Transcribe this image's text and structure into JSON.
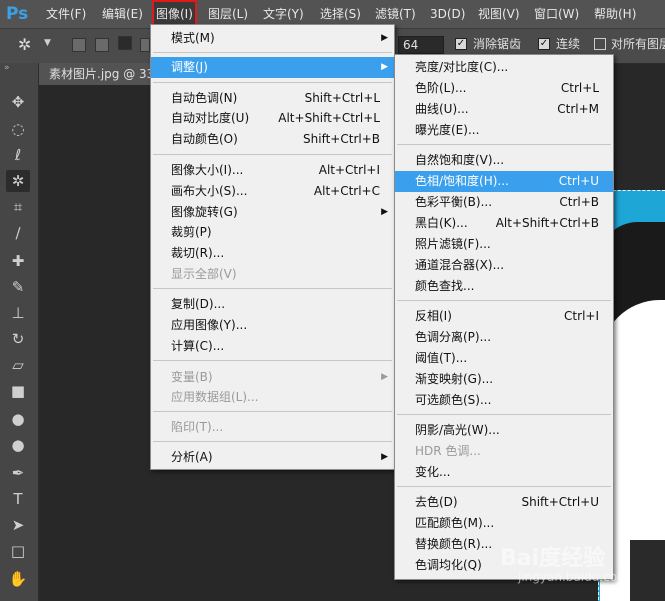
{
  "app": {
    "logo": "Ps"
  },
  "menubar": {
    "items": [
      {
        "label": "文件(F)"
      },
      {
        "label": "编辑(E)"
      },
      {
        "label": "图像(I)"
      },
      {
        "label": "图层(L)"
      },
      {
        "label": "文字(Y)"
      },
      {
        "label": "选择(S)"
      },
      {
        "label": "滤镜(T)"
      },
      {
        "label": "3D(D)"
      },
      {
        "label": "视图(V)"
      },
      {
        "label": "窗口(W)"
      },
      {
        "label": "帮助(H)"
      }
    ],
    "active": "图像(I)"
  },
  "options": {
    "tolerance_value": "64",
    "antialias_label": "消除锯齿",
    "contiguous_label": "连续",
    "sample_all_label": "对所有图层"
  },
  "document": {
    "tab_label": "素材图片.jpg @ 33"
  },
  "image_menu": {
    "items": [
      {
        "label": "模式(M)",
        "shortcut": "",
        "submenu": true,
        "disabled": false
      },
      {
        "label": "调整(J)",
        "shortcut": "",
        "submenu": true,
        "disabled": false,
        "highlighted": true
      },
      {
        "label": "自动色调(N)",
        "shortcut": "Shift+Ctrl+L"
      },
      {
        "label": "自动对比度(U)",
        "shortcut": "Alt+Shift+Ctrl+L"
      },
      {
        "label": "自动颜色(O)",
        "shortcut": "Shift+Ctrl+B"
      },
      {
        "label": "图像大小(I)...",
        "shortcut": "Alt+Ctrl+I"
      },
      {
        "label": "画布大小(S)...",
        "shortcut": "Alt+Ctrl+C"
      },
      {
        "label": "图像旋转(G)",
        "shortcut": "",
        "submenu": true
      },
      {
        "label": "裁剪(P)",
        "shortcut": ""
      },
      {
        "label": "裁切(R)...",
        "shortcut": ""
      },
      {
        "label": "显示全部(V)",
        "shortcut": "",
        "disabled": true
      },
      {
        "label": "复制(D)...",
        "shortcut": ""
      },
      {
        "label": "应用图像(Y)...",
        "shortcut": ""
      },
      {
        "label": "计算(C)...",
        "shortcut": ""
      },
      {
        "label": "变量(B)",
        "shortcut": "",
        "submenu": true,
        "disabled": true
      },
      {
        "label": "应用数据组(L)...",
        "shortcut": "",
        "disabled": true
      },
      {
        "label": "陷印(T)...",
        "shortcut": "",
        "disabled": true
      },
      {
        "label": "分析(A)",
        "shortcut": "",
        "submenu": true
      }
    ]
  },
  "adjust_menu": {
    "items": [
      {
        "label": "亮度/对比度(C)...",
        "shortcut": ""
      },
      {
        "label": "色阶(L)...",
        "shortcut": "Ctrl+L"
      },
      {
        "label": "曲线(U)...",
        "shortcut": "Ctrl+M"
      },
      {
        "label": "曝光度(E)...",
        "shortcut": ""
      },
      {
        "label": "自然饱和度(V)...",
        "shortcut": ""
      },
      {
        "label": "色相/饱和度(H)...",
        "shortcut": "Ctrl+U",
        "highlighted": true
      },
      {
        "label": "色彩平衡(B)...",
        "shortcut": "Ctrl+B"
      },
      {
        "label": "黑白(K)...",
        "shortcut": "Alt+Shift+Ctrl+B"
      },
      {
        "label": "照片滤镜(F)...",
        "shortcut": ""
      },
      {
        "label": "通道混合器(X)...",
        "shortcut": ""
      },
      {
        "label": "颜色查找...",
        "shortcut": ""
      },
      {
        "label": "反相(I)",
        "shortcut": "Ctrl+I"
      },
      {
        "label": "色调分离(P)...",
        "shortcut": ""
      },
      {
        "label": "阈值(T)...",
        "shortcut": ""
      },
      {
        "label": "渐变映射(G)...",
        "shortcut": ""
      },
      {
        "label": "可选颜色(S)...",
        "shortcut": ""
      },
      {
        "label": "阴影/高光(W)...",
        "shortcut": ""
      },
      {
        "label": "HDR 色调...",
        "shortcut": "",
        "disabled": true
      },
      {
        "label": "变化...",
        "shortcut": ""
      },
      {
        "label": "去色(D)",
        "shortcut": "Shift+Ctrl+U"
      },
      {
        "label": "匹配颜色(M)...",
        "shortcut": ""
      },
      {
        "label": "替换颜色(R)...",
        "shortcut": ""
      },
      {
        "label": "色调均化(Q)",
        "shortcut": ""
      }
    ]
  },
  "watermark": {
    "main": "Bai度经验",
    "sub": "jingyan.baidu.com"
  },
  "colors": {
    "menu_highlight": "#3aa0ee",
    "active_outline": "#e01a1a",
    "canvas_blue": "#1ea6d6"
  }
}
